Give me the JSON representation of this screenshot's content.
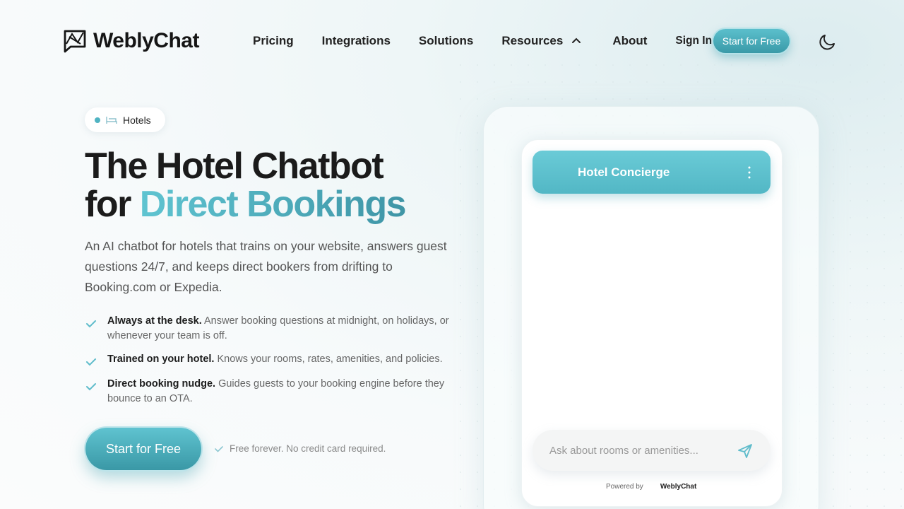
{
  "brand": {
    "name": "WeblyChat"
  },
  "nav": {
    "links": [
      "Pricing",
      "Integrations",
      "Solutions",
      "Resources",
      "About"
    ],
    "sign_in": "Sign In",
    "cta": "Start for Free"
  },
  "hero": {
    "pill": "Hotels",
    "title_line1": "The Hotel Chatbot",
    "title_line2_prefix": "for ",
    "title_line2_accent": "Direct Bookings",
    "lead": "An AI chatbot for hotels that trains on your website, answers guest questions 24/7, and keeps direct bookers from drifting to Booking.com or Expedia.",
    "features": [
      {
        "bold": "Always at the desk.",
        "text": " Answer booking questions at midnight, on holidays, or whenever your team is off."
      },
      {
        "bold": "Trained on your hotel.",
        "text": " Knows your rooms, rates, amenities, and policies."
      },
      {
        "bold": "Direct booking nudge.",
        "text": " Guides guests to your booking engine before they bounce to an OTA."
      }
    ],
    "cta": "Start for Free",
    "cta_note": "Free forever. No credit card required."
  },
  "chat": {
    "title": "Hotel Concierge",
    "input_placeholder": "Ask about rooms or amenities...",
    "powered_by_label": "Powered by",
    "powered_by_brand": "WeblyChat"
  },
  "colors": {
    "accent": "#52b7c5",
    "accent_dark": "#3a98a6"
  }
}
